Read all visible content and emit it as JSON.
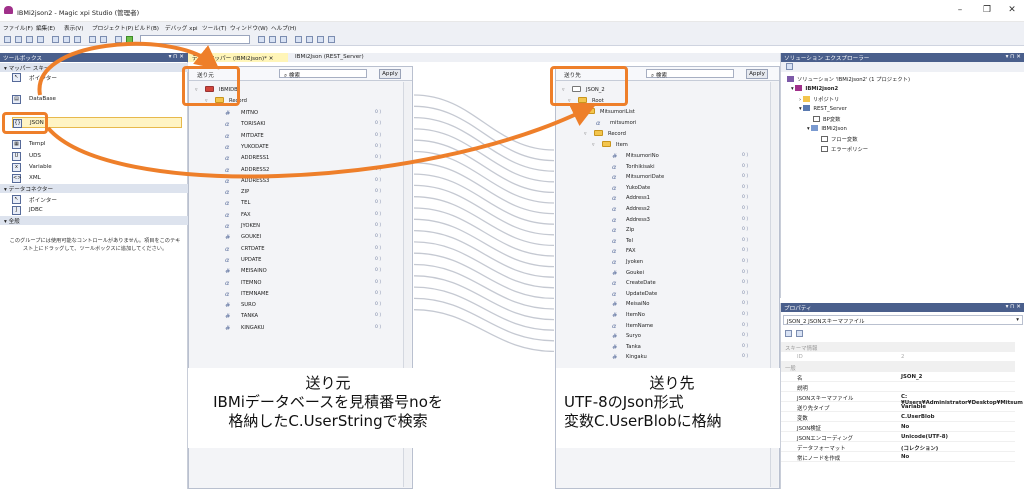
{
  "window": {
    "title": "IBMi2json2 - Magic xpi Studio (管理者)",
    "minimize": "–",
    "restore": "❐",
    "close": "✕"
  },
  "menu": [
    "ファイル(F)",
    "編集(E)",
    "表示(V)",
    "プロジェクト(P)",
    "ビルド(B)",
    "デバッグ xpi",
    "ツール(T)",
    "ウィンドウ(W)",
    "ヘルプ(H)"
  ],
  "toolbox": {
    "title": "ツールボックス",
    "pin": "▾ ⊓ ✕",
    "sections": {
      "mapper": "マッパー スキー",
      "connector": "データコネクター",
      "all": "全般"
    },
    "items": {
      "pointer": "ポインター",
      "database": "DataBase",
      "json": "JSON",
      "template": "Templ",
      "uds": "UDS",
      "variable": "Variable",
      "xml": "XML",
      "pointer2": "ポインター",
      "jdbc": "JDBC"
    },
    "icons": {
      "pointer": "pointer-icon",
      "database": "database-icon",
      "json": "json-icon",
      "template": "template-icon",
      "uds": "uds-icon",
      "variable": "variable-icon",
      "xml": "xml-icon",
      "jdbc": "jdbc-icon"
    },
    "empty_msg_1": "このグループには使用可能なコントロールがありません。項目をこのテキ",
    "empty_msg_2": "スト上にドラッグして、ツールボックスに追加してください。"
  },
  "tabs": [
    {
      "label": "データマッパー (IBMi2json)*",
      "close": "✕"
    },
    {
      "label": "IBMi2Json (REST_Server)"
    }
  ],
  "source": {
    "label": "送り元",
    "search_placeholder": "検索",
    "apply": "Apply",
    "root": "IBMIDB",
    "record": "Record",
    "fields": [
      "MITNO",
      "TORISAKI",
      "MITDATE",
      "YUKODATE",
      "ADDRESS1",
      "ADDRESS2",
      "ADDRESS3",
      "ZIP",
      "TEL",
      "FAX",
      "JYOKEN",
      "GOUKEI",
      "CRTDATE",
      "UPDATE",
      "MEISAINO",
      "ITEMNO",
      "ITEMNAME",
      "SURO",
      "TANKA",
      "KINGAKU"
    ],
    "types": [
      "#",
      "α",
      "α",
      "α",
      "α",
      "α",
      "α",
      "α",
      "α",
      "α",
      "α",
      "#",
      "α",
      "α",
      "#",
      "α",
      "α",
      "#",
      "#",
      "#"
    ],
    "param": "0 ⟩"
  },
  "dest": {
    "label": "送り先",
    "search_placeholder": "検索",
    "apply": "Apply",
    "root": "JSON_2",
    "r": "Root",
    "list": "MitsumoriList",
    "item": "mitsumori",
    "record": "Record",
    "it": "Item",
    "fields": [
      "MitsumoriNo",
      "Torihikisaki",
      "MitsumoriDate",
      "YukoDate",
      "Address1",
      "Address2",
      "Address3",
      "Zip",
      "Tel",
      "FAX",
      "Jyoken",
      "Goukei",
      "CreateDate",
      "UpdateDate",
      "MeisaiNo",
      "ItemNo",
      "ItemName",
      "Suryo",
      "Tanka",
      "Kingaku"
    ],
    "types": [
      "#",
      "α",
      "α",
      "α",
      "α",
      "α",
      "α",
      "α",
      "α",
      "α",
      "α",
      "#",
      "α",
      "α",
      "#",
      "#",
      "α",
      "#",
      "#",
      "#"
    ],
    "param": "0 ⟩"
  },
  "callouts": {
    "left": [
      "送り元",
      "IBMiデータベースを見積番号noを",
      "格納したC.UserStringで検索"
    ],
    "right": [
      "送り先",
      "UTF-8のJson形式",
      "変数C.UserBlobに格納"
    ]
  },
  "solution": {
    "title": "ソリューション エクスプローラー",
    "items": [
      "ソリューション 'IBMi2json2' (1 プロジェクト)",
      "IBMi2json2",
      "リポジトリ",
      "REST_Server",
      "BP変数",
      "IBMi2Json",
      "フロー変数",
      "エラーポリシー"
    ]
  },
  "properties": {
    "title": "プロパティ",
    "selector": "JSON_2 JSONスキーマファイル",
    "cat1": "スキーマ情報",
    "cat2": "一般",
    "rows": [
      [
        "ID",
        "2"
      ],
      [
        "名",
        "JSON_2"
      ],
      [
        "説明",
        ""
      ],
      [
        "JSONスキーマファイル",
        "C:¥Users¥Administrator¥Desktop¥Mitsum"
      ],
      [
        "送り先タイプ",
        "Variable"
      ],
      [
        "変数",
        "C.UserBlob"
      ],
      [
        "JSON検証",
        "No"
      ],
      [
        "JSONエンコーディング",
        "Unicode(UTF-8)"
      ],
      [
        "データフォーマット",
        "(コレクション)"
      ],
      [
        "常にノードを作成",
        "No"
      ]
    ]
  },
  "colors": {
    "accent": "#ee7f2a",
    "panel_title": "#4a5f8c",
    "selected": "#fff4c4"
  }
}
